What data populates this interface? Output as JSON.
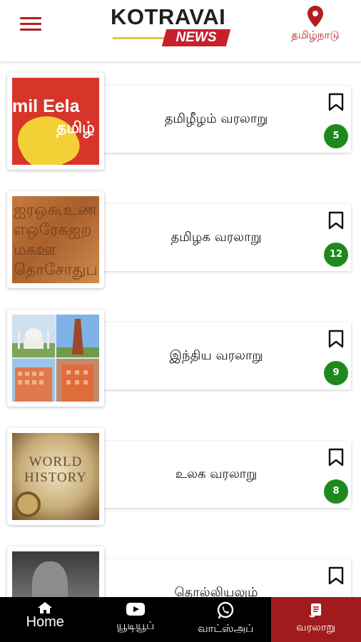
{
  "header": {
    "logo_title": "KOTRAVAI",
    "logo_subtitle": "NEWS",
    "location_label": "தமிழ்நாடு",
    "accent_color": "#b31d1d"
  },
  "items": [
    {
      "title": "தமிழீழம் வரலாறு",
      "count": "5",
      "thumb_text": "mil Eela",
      "thumb_text2": "தமிழ்"
    },
    {
      "title": "தமிழக வரலாறு",
      "count": "12",
      "thumb_glyphs": "ஐரஒகூஉணஎஒரேகஐறமகஊதொசோதுபஎ"
    },
    {
      "title": "இந்திய வரலாறு",
      "count": "9"
    },
    {
      "title": "உலக வரலாறு",
      "count": "8",
      "thumb_text": "WORLD",
      "thumb_text2": "HISTORY"
    },
    {
      "title": "தொல்லியலும்",
      "count": ""
    }
  ],
  "nav": {
    "home": "Home",
    "youtube": "யூடியூப்",
    "whatsapp": "வாட்ஸ்அப்",
    "history": "வரலாறு"
  },
  "icons": {
    "menu": "hamburger-icon",
    "location": "location-pin-icon",
    "bookmark": "bookmark-icon",
    "home": "home-icon",
    "youtube": "youtube-icon",
    "whatsapp": "whatsapp-icon",
    "history": "scroll-icon"
  },
  "colors": {
    "badge": "#1e8a1e",
    "nav_bg": "#000000",
    "nav_active": "#a01c1c"
  }
}
